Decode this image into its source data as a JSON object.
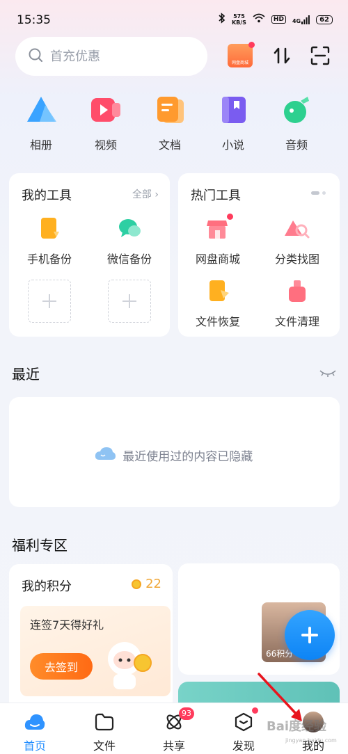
{
  "status_bar": {
    "time": "15:35",
    "net_speed_value": "575",
    "net_speed_unit": "KB/S",
    "hd": "HD",
    "signal": "4G",
    "battery": "62"
  },
  "search": {
    "placeholder": "首充优惠"
  },
  "header": {
    "promo_label": "网盘商城"
  },
  "quick_entries": [
    {
      "label": "相册",
      "icon": "album-icon",
      "color": "#3aa3ff"
    },
    {
      "label": "视频",
      "icon": "video-icon",
      "color": "#ff4d6a"
    },
    {
      "label": "文档",
      "icon": "document-icon",
      "color": "#ff9a2e"
    },
    {
      "label": "小说",
      "icon": "novel-icon",
      "color": "#7a5cf0"
    },
    {
      "label": "音频",
      "icon": "audio-icon",
      "color": "#2dd08f"
    }
  ],
  "my_tools": {
    "title": "我的工具",
    "more": "全部",
    "items": [
      {
        "label": "手机备份",
        "icon": "phone-backup-icon"
      },
      {
        "label": "微信备份",
        "icon": "wechat-backup-icon"
      }
    ]
  },
  "hot_tools": {
    "title": "热门工具",
    "items": [
      {
        "label": "网盘商城",
        "icon": "store-icon"
      },
      {
        "label": "分类找图",
        "icon": "find-image-icon"
      },
      {
        "label": "文件恢复",
        "icon": "file-recovery-icon"
      },
      {
        "label": "文件清理",
        "icon": "file-clean-icon"
      }
    ]
  },
  "recent": {
    "title": "最近",
    "empty_text": "最近使用过的内容已隐藏"
  },
  "welfare": {
    "title": "福利专区",
    "points_title": "我的积分",
    "points_value": "22",
    "signin_text": "连签7天得好礼",
    "signin_button": "去签到",
    "feed_label": "66积分"
  },
  "tabbar": [
    {
      "label": "首页",
      "icon": "home-icon",
      "active": true
    },
    {
      "label": "文件",
      "icon": "folder-icon"
    },
    {
      "label": "共享",
      "icon": "share-icon",
      "badge": "93"
    },
    {
      "label": "发现",
      "icon": "discover-icon"
    },
    {
      "label": "我的",
      "icon": "profile-avatar-icon"
    }
  ],
  "watermark": {
    "text": "Bai度经验",
    "sub": "jingyan.baidu.com"
  }
}
